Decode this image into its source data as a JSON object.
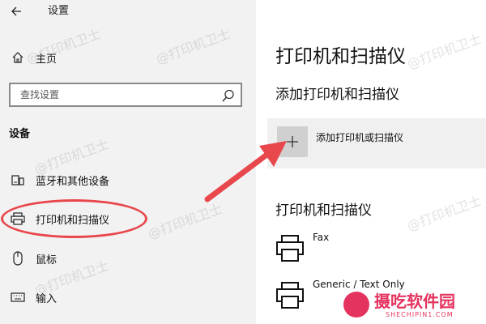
{
  "window": {
    "title": "设置"
  },
  "icons": {
    "back": "back-arrow-icon",
    "home": "home-icon",
    "search": "search-icon",
    "bluetooth": "bluetooth-devices-icon",
    "printer": "printer-icon",
    "mouse": "mouse-icon",
    "input": "keyboard-icon",
    "add": "plus-icon"
  },
  "sidebar": {
    "home_label": "主页",
    "search_placeholder": "查找设置",
    "section_header": "设备",
    "items": [
      {
        "label": "蓝牙和其他设备"
      },
      {
        "label": "打印机和扫描仪",
        "highlighted": true
      },
      {
        "label": "鼠标"
      },
      {
        "label": "输入"
      }
    ]
  },
  "main": {
    "page_title": "打印机和扫描仪",
    "add_section_title": "添加打印机和扫描仪",
    "add_button_label": "添加打印机或扫描仪",
    "list_section_title": "打印机和扫描仪",
    "printers": [
      {
        "name": "Fax"
      },
      {
        "name": "Generic / Text Only"
      }
    ]
  },
  "overlay": {
    "watermark_text": "@打印机卫士",
    "annotation_color": "#e8474c",
    "brand_name": "摄吃软件园",
    "brand_url": "SHECHIPIN1.COM",
    "brand_color": "#e5335f"
  }
}
